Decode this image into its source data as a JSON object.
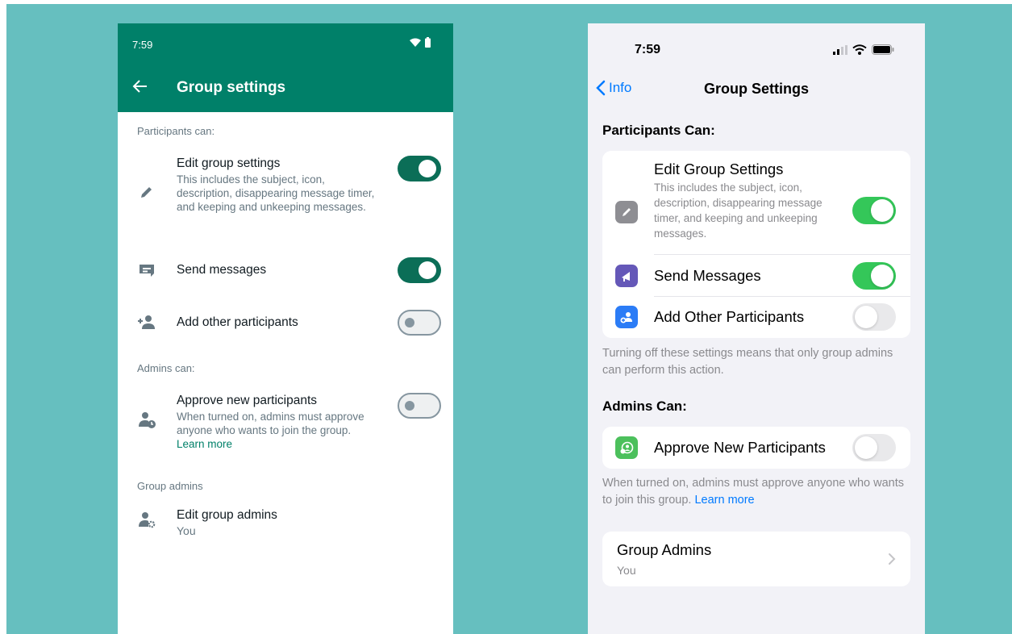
{
  "android": {
    "status_time": "7:59",
    "title": "Group settings",
    "sections": {
      "participants": "Participants can:",
      "admins": "Admins can:",
      "group_admins": "Group admins"
    },
    "rows": {
      "edit_settings": {
        "label": "Edit group settings",
        "desc": "This includes the subject, icon, description, disappearing message timer, and keeping and unkeeping messages.",
        "enabled": true
      },
      "send_messages": {
        "label": "Send messages",
        "enabled": true
      },
      "add_participants": {
        "label": "Add other participants",
        "enabled": false
      },
      "approve": {
        "label": "Approve new participants",
        "desc": "When turned on, admins must approve anyone who wants to join the group.",
        "link": "Learn more",
        "enabled": false
      },
      "edit_admins": {
        "label": "Edit group admins",
        "sub": "You"
      }
    },
    "colors": {
      "header": "#008069",
      "toggle_on": "#0b6e57"
    }
  },
  "ios": {
    "status_time": "7:59",
    "back_label": "Info",
    "title": "Group Settings",
    "participants_header": "Participants Can:",
    "rows": {
      "edit_settings": {
        "label": "Edit Group Settings",
        "desc": "This includes the subject, icon, description, disappearing message timer, and keeping and unkeeping messages.",
        "enabled": true,
        "icon": "pencil-icon"
      },
      "send_messages": {
        "label": "Send Messages",
        "enabled": true,
        "icon": "megaphone-icon"
      },
      "add_participants": {
        "label": "Add Other Participants",
        "enabled": false,
        "icon": "add-person-icon"
      },
      "approve": {
        "label": "Approve New Participants",
        "enabled": false,
        "icon": "approve-person-icon"
      }
    },
    "participants_footer": "Turning off these settings means that only group admins can perform this action.",
    "admins_header": "Admins Can:",
    "approve_footer": "When turned on, admins must approve anyone who wants to join this group.",
    "approve_footer_link": "Learn more",
    "group_admins": {
      "label": "Group Admins",
      "sub": "You"
    },
    "colors": {
      "toggle_on": "#34c759",
      "link": "#007aff"
    }
  }
}
